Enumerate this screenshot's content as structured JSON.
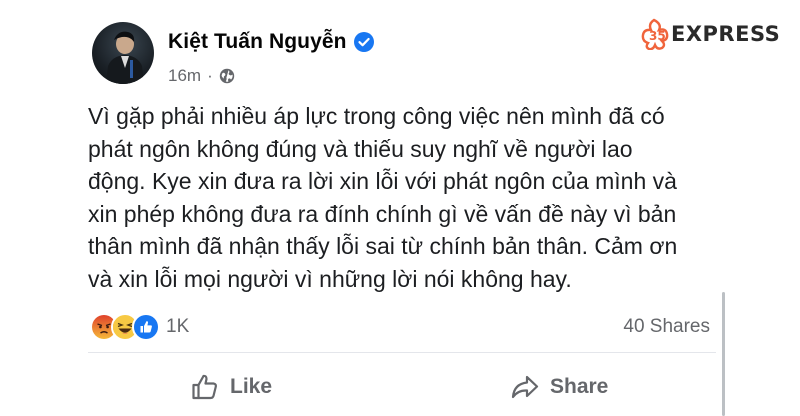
{
  "post": {
    "author": "Kiệt Tuấn Nguyễn",
    "time": "16m",
    "separator": "·",
    "body_lines": [
      "Vì gặp phải nhiều áp lực trong công việc nên mình đã có",
      "phát ngôn không đúng và thiếu suy nghĩ về người lao",
      "động. Kye xin đưa ra lời xin lỗi với phát ngôn của mình và",
      "xin phép không đưa ra đính chính gì về vấn đề này vì bản",
      "thân mình đã nhận thấy lỗi sai từ chính bản thân. Cảm ơn",
      "và xin lỗi mọi người vì những lời nói không hay."
    ]
  },
  "engagement": {
    "reaction_icons": [
      "angry-reaction-icon",
      "haha-reaction-icon",
      "like-reaction-icon"
    ],
    "reaction_count": "1K",
    "shares": "40 Shares"
  },
  "actions": {
    "like": "Like",
    "share": "Share"
  },
  "watermark": {
    "text": "EXPRESS",
    "brand_color": "#f0643c"
  },
  "colors": {
    "verified": "#1877f2",
    "secondary_text": "#65676b"
  }
}
